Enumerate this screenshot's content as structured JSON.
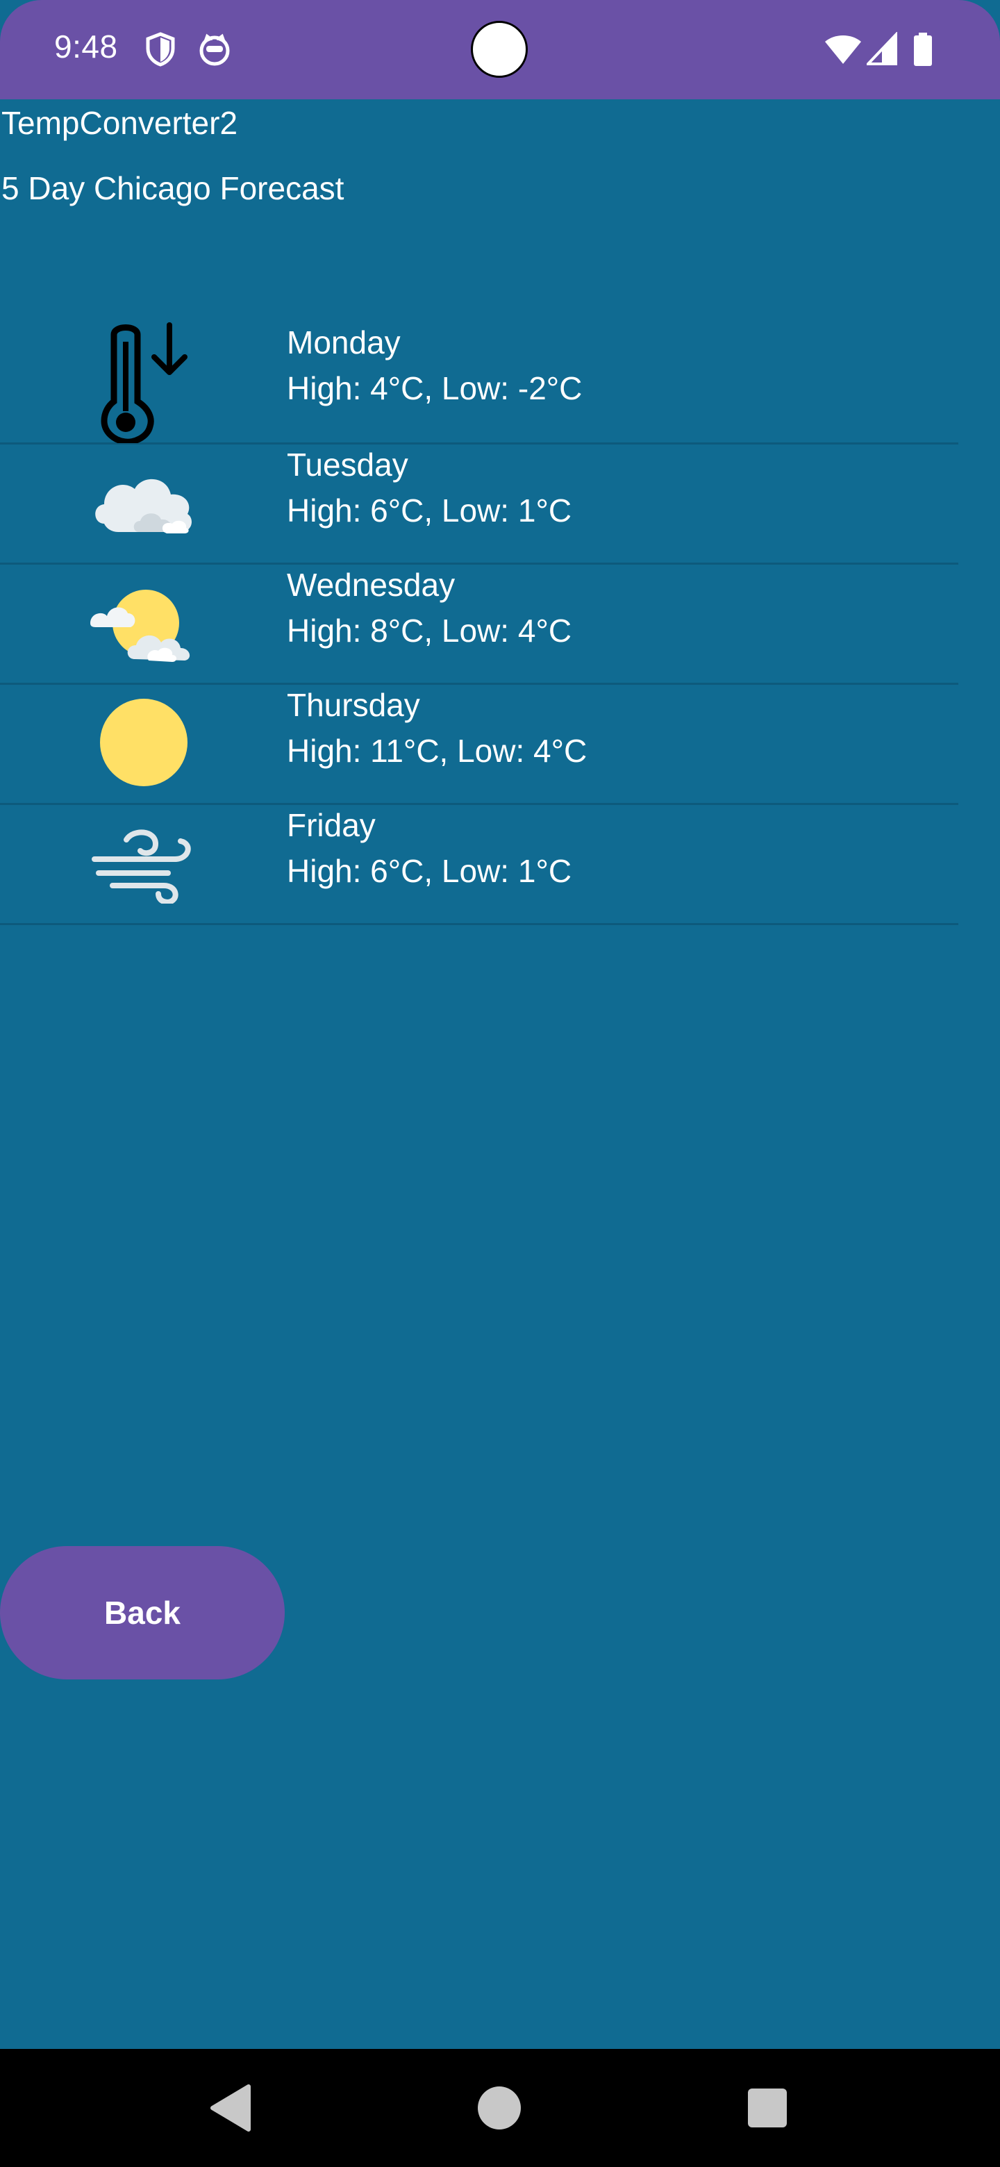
{
  "status_bar": {
    "time": "9:48",
    "left_icons": [
      "shield-icon",
      "cat-face-icon"
    ],
    "right_icons": [
      "wifi-icon",
      "cellular-signal-icon",
      "battery-icon"
    ],
    "bar_color": "#6a51a6"
  },
  "app": {
    "title": "TempConverter2",
    "background_color": "#106b92"
  },
  "forecast": {
    "heading": "5 Day Chicago Forecast",
    "days": [
      {
        "day": "Monday",
        "temps": "High: 4°C, Low: -2°C",
        "icon": "thermometer-down-icon"
      },
      {
        "day": "Tuesday",
        "temps": "High: 6°C, Low: 1°C",
        "icon": "cloudy-icon"
      },
      {
        "day": "Wednesday",
        "temps": "High: 8°C, Low: 4°C",
        "icon": "partly-cloudy-icon"
      },
      {
        "day": "Thursday",
        "temps": "High: 11°C, Low: 4°C",
        "icon": "sun-icon"
      },
      {
        "day": "Friday",
        "temps": "High: 6°C, Low: 1°C",
        "icon": "wind-icon"
      }
    ]
  },
  "actions": {
    "back_label": "Back",
    "button_color": "#6a51a6"
  },
  "nav_bar": {
    "buttons": [
      "back-triangle-icon",
      "home-circle-icon",
      "recents-square-icon"
    ]
  }
}
